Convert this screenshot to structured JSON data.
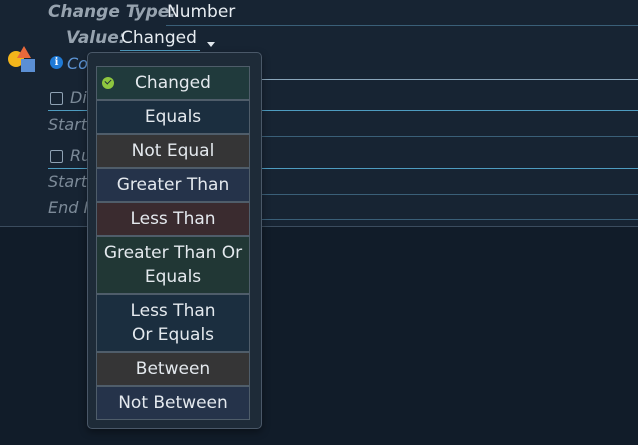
{
  "form": {
    "change_type_label": "Change Type:",
    "change_type_value": "Number",
    "value_label": "Value:",
    "value_selected": "Changed",
    "info_partial": "Co",
    "row1_checkbox_partial": "Di",
    "row1_start_partial": "Start",
    "row2_checkbox_partial": "Ru",
    "row2_start_partial": "Start",
    "row2_end_partial": "End I"
  },
  "dropdown": {
    "options": [
      {
        "label": "Changed",
        "selected": true,
        "bg": "#203a3c"
      },
      {
        "label": "Equals",
        "selected": false,
        "bg": "#1b2e3f"
      },
      {
        "label": "Not Equal",
        "selected": false,
        "bg": "#353536"
      },
      {
        "label": "Greater Than",
        "selected": false,
        "bg": "#25334a"
      },
      {
        "label": "Less Than",
        "selected": false,
        "bg": "#3a2b2f"
      },
      {
        "label": "Greater Than Or Equals",
        "selected": false,
        "bg": "#213735"
      },
      {
        "label": "Less Than Or Equals",
        "selected": false,
        "bg": "#1b2e3f"
      },
      {
        "label": "Between",
        "selected": false,
        "bg": "#353536"
      },
      {
        "label": "Not Between",
        "selected": false,
        "bg": "#25334a"
      }
    ]
  },
  "colors": {
    "background": "#111c29",
    "panel": "#172433",
    "accent_line": "#4e9cc0",
    "check": "#8ec63f"
  }
}
